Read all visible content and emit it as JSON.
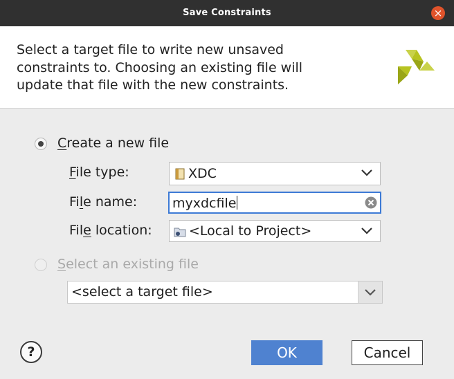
{
  "dialog": {
    "title": "Save Constraints",
    "close_label": "×",
    "description_lines": [
      "Select a target file to write new unsaved",
      "constraints to. Choosing an existing file will",
      "update that file with the new constraints."
    ]
  },
  "create_new": {
    "label_mnemonic": "C",
    "label_rest": "reate a new file",
    "selected": true,
    "file_type": {
      "label_mnemonic": "F",
      "label_rest": "ile type:",
      "value": "XDC"
    },
    "file_name": {
      "label_pre": "Fi",
      "label_mnemonic": "l",
      "label_rest": "e name:",
      "value": "myxdcfile"
    },
    "file_location": {
      "label_pre": "Fil",
      "label_mnemonic": "e",
      "label_rest": " location:",
      "value": "<Local to Project>"
    }
  },
  "select_existing": {
    "label_mnemonic": "S",
    "label_rest": "elect an existing file",
    "selected": false,
    "enabled": false,
    "target_value": "<select a target file>"
  },
  "buttons": {
    "help": "?",
    "ok": "OK",
    "cancel": "Cancel"
  },
  "colors": {
    "titlebar": "#303030",
    "close": "#e0532b",
    "ok": "#4f82d0",
    "focus": "#3d7ad6",
    "logo": "#b7c320"
  }
}
